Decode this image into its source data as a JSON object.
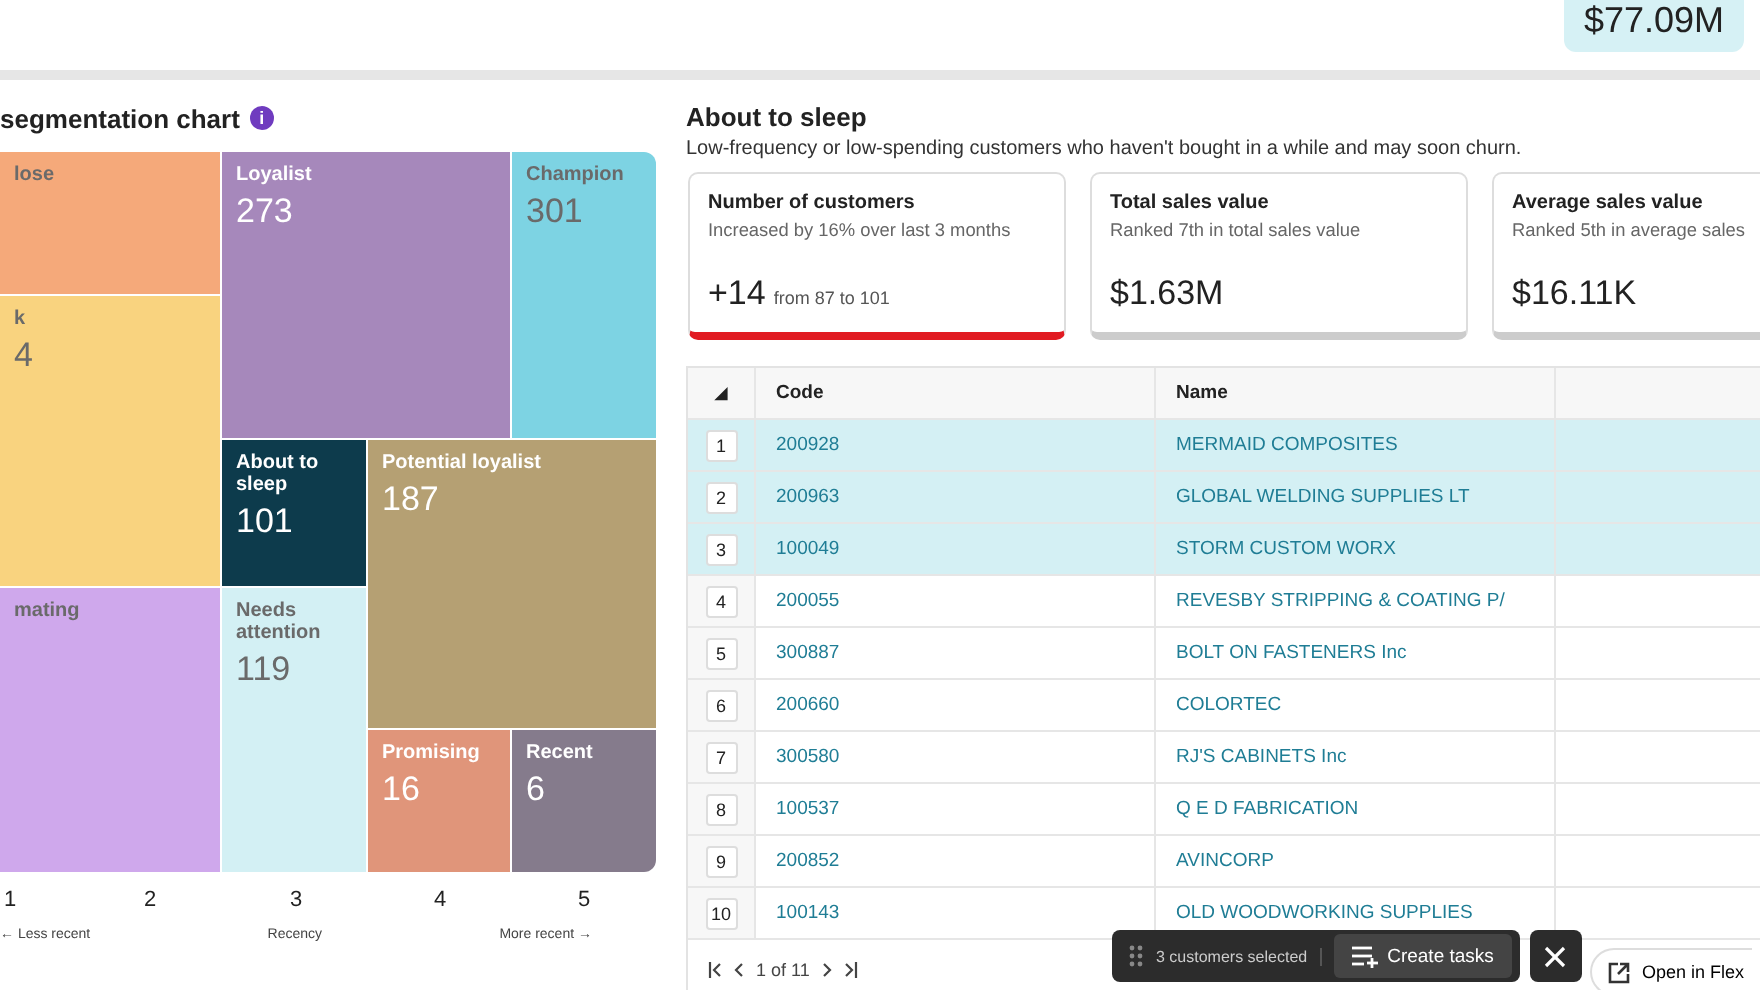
{
  "header": {
    "total": "$77.09M"
  },
  "chart": {
    "title": "segmentation chart",
    "info": "i",
    "tiles": [
      {
        "label": "lose",
        "color": "#f5a97a",
        "dark": false
      },
      {
        "label": "k",
        "value": "4",
        "color": "#f9d37f",
        "dark": false
      },
      {
        "label": "mating",
        "color": "#cfa8ec",
        "dark": false
      },
      {
        "label": "Loyalist",
        "value": "273",
        "color": "#a688bb",
        "dark": true
      },
      {
        "label": "Champion",
        "value": "301",
        "color": "#7dd3e3",
        "dark": false
      },
      {
        "label": "About to sleep",
        "value": "101",
        "color": "#0d3b4c",
        "dark": true
      },
      {
        "label": "Needs attention",
        "value": "119",
        "color": "#d3f0f4",
        "dark": false
      },
      {
        "label": "Potential loyalist",
        "value": "187",
        "color": "#b5a073",
        "dark": true
      },
      {
        "label": "Promising",
        "value": "16",
        "color": "#e0957a",
        "dark": true
      },
      {
        "label": "Recent",
        "value": "6",
        "color": "#857b8c",
        "dark": true
      }
    ],
    "axis_ticks": [
      "1",
      "2",
      "3",
      "4",
      "5"
    ],
    "axis_labels": [
      "← Less recent",
      "Recency",
      "More recent →"
    ]
  },
  "segment": {
    "title": "About to sleep",
    "description": "Low-frequency or low-spending customers who haven't bought in a while and may soon churn.",
    "cards": [
      {
        "title": "Number of customers",
        "subtitle": "Increased by 16% over last 3 months",
        "value": "+14",
        "note": "from 87 to 101",
        "selected": true
      },
      {
        "title": "Total sales value",
        "subtitle": "Ranked 7th in total sales value",
        "value": "$1.63M",
        "selected": false
      },
      {
        "title": "Average sales value",
        "subtitle": "Ranked 5th in average sales",
        "value": "$16.11K",
        "selected": false
      }
    ]
  },
  "table": {
    "sort_icon": "◢",
    "columns": [
      "Code",
      "Name"
    ],
    "rows": [
      {
        "index": "1",
        "code": "200928",
        "name": "MERMAID COMPOSITES",
        "selected": true
      },
      {
        "index": "2",
        "code": "200963",
        "name": "GLOBAL WELDING SUPPLIES LT",
        "selected": true
      },
      {
        "index": "3",
        "code": "100049",
        "name": "STORM CUSTOM WORX",
        "selected": true
      },
      {
        "index": "4",
        "code": "200055",
        "name": "REVESBY STRIPPING & COATING P/",
        "selected": false
      },
      {
        "index": "5",
        "code": "300887",
        "name": "BOLT ON FASTENERS Inc",
        "selected": false
      },
      {
        "index": "6",
        "code": "200660",
        "name": "COLORTEC",
        "selected": false
      },
      {
        "index": "7",
        "code": "300580",
        "name": "RJ'S CABINETS Inc",
        "selected": false
      },
      {
        "index": "8",
        "code": "100537",
        "name": "Q E D FABRICATION",
        "selected": false
      },
      {
        "index": "9",
        "code": "200852",
        "name": "AVINCORP",
        "selected": false
      },
      {
        "index": "10",
        "code": "100143",
        "name": "OLD WOODWORKING SUPPLIES",
        "selected": false
      }
    ],
    "pagination": "1 of 11"
  },
  "selection_bar": {
    "count": "3 customers selected",
    "action": "Create tasks"
  },
  "open_button": "Open in Flex"
}
